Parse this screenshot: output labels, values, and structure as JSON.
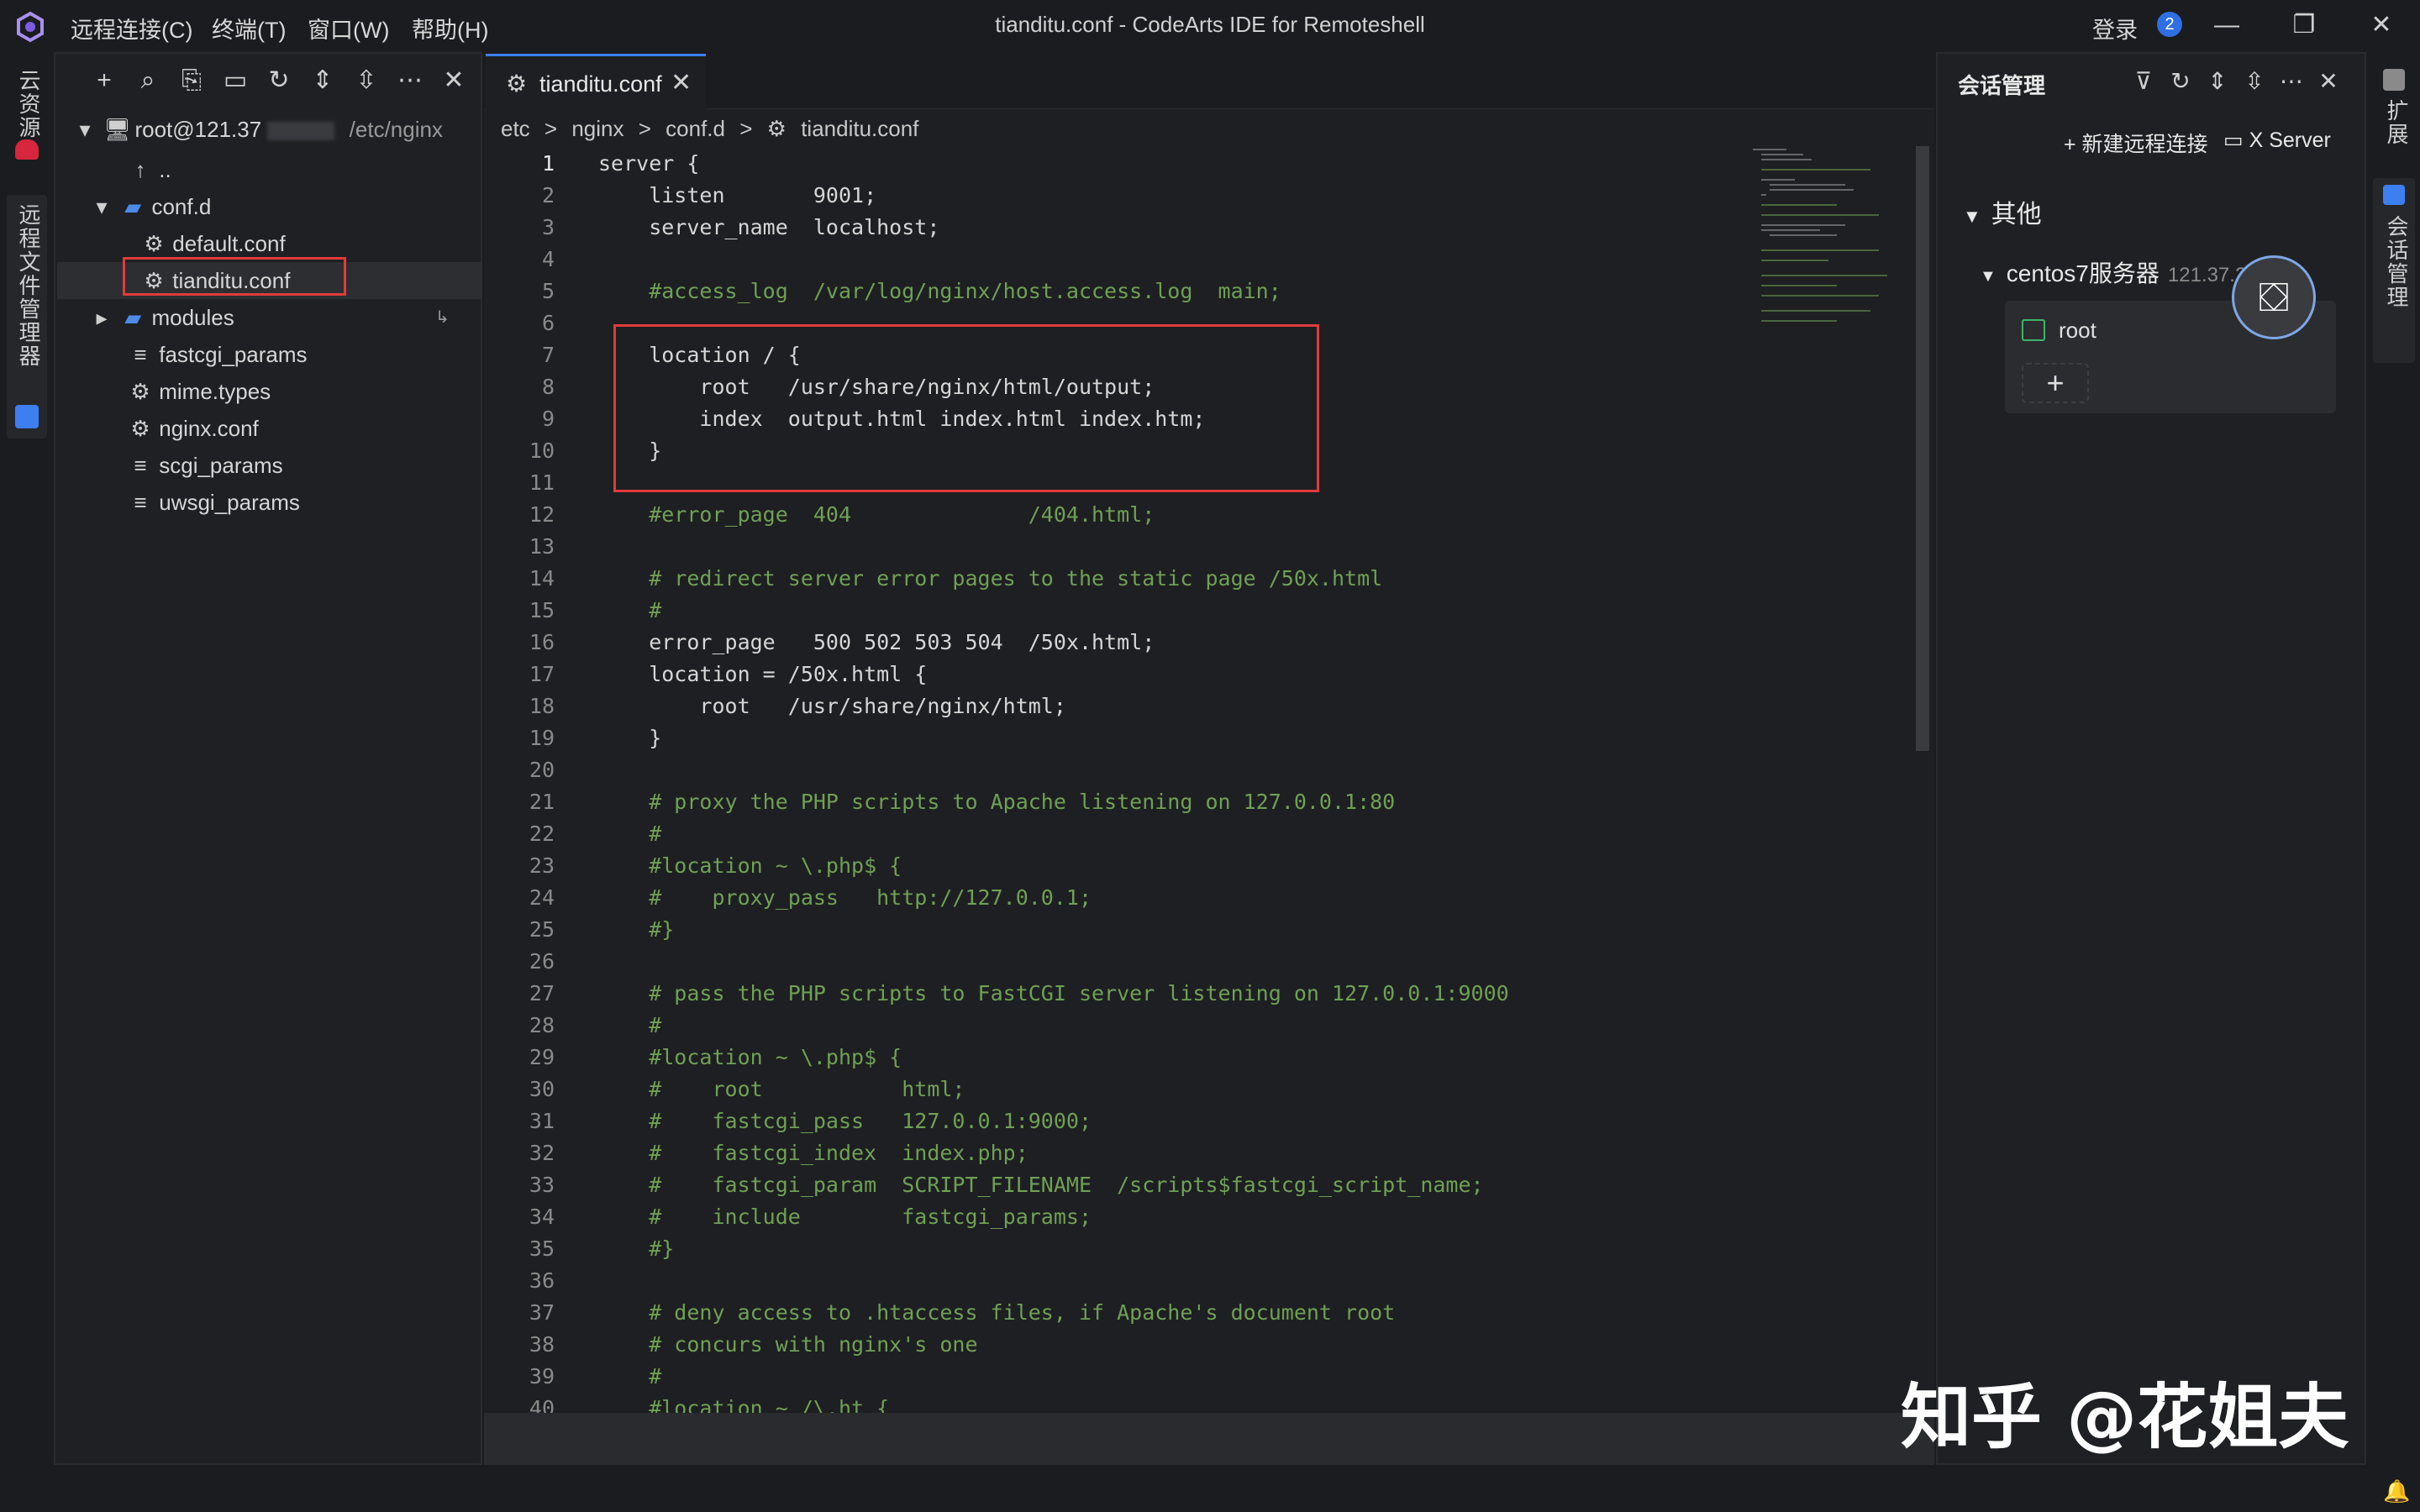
{
  "window": {
    "title": "tianditu.conf - CodeArts IDE for Remoteshell",
    "menu": [
      "远程连接(C)",
      "终端(T)",
      "窗口(W)",
      "帮助(H)"
    ],
    "login": "登录",
    "notification_count": "2"
  },
  "left_activity": {
    "cloud_resources": "云资源",
    "remote_file_manager": "远程文件管理器"
  },
  "right_activity": {
    "extensions": "扩展",
    "session_manager": "会话管理"
  },
  "explorer": {
    "root": "root@121.37",
    "root_path": "/etc/nginx",
    "items": [
      {
        "label": "..",
        "icon": "arrow-up-icon"
      },
      {
        "label": "conf.d",
        "icon": "folder-open-icon"
      },
      {
        "label": "default.conf",
        "icon": "gear-icon"
      },
      {
        "label": "tianditu.conf",
        "icon": "gear-icon"
      },
      {
        "label": "modules",
        "icon": "folder-icon"
      },
      {
        "label": "fastcgi_params",
        "icon": "file-lines-icon"
      },
      {
        "label": "mime.types",
        "icon": "gear-icon"
      },
      {
        "label": "nginx.conf",
        "icon": "gear-icon"
      },
      {
        "label": "scgi_params",
        "icon": "file-lines-icon"
      },
      {
        "label": "uwsgi_params",
        "icon": "file-lines-icon"
      }
    ]
  },
  "editor": {
    "tab": "tianditu.conf",
    "breadcrumb": [
      "etc",
      ">",
      "nginx",
      ">",
      "conf.d",
      ">",
      "tianditu.conf"
    ],
    "lines": [
      "server {",
      "    listen       9001;",
      "    server_name  localhost;",
      "",
      "    #access_log  /var/log/nginx/host.access.log  main;",
      "",
      "    location / {",
      "        root   /usr/share/nginx/html/output;",
      "        index  output.html index.html index.htm;",
      "    }",
      "",
      "    #error_page  404              /404.html;",
      "",
      "    # redirect server error pages to the static page /50x.html",
      "    #",
      "    error_page   500 502 503 504  /50x.html;",
      "    location = /50x.html {",
      "        root   /usr/share/nginx/html;",
      "    }",
      "",
      "    # proxy the PHP scripts to Apache listening on 127.0.0.1:80",
      "    #",
      "    #location ~ \\.php$ {",
      "    #    proxy_pass   http://127.0.0.1;",
      "    #}",
      "",
      "    # pass the PHP scripts to FastCGI server listening on 127.0.0.1:9000",
      "    #",
      "    #location ~ \\.php$ {",
      "    #    root           html;",
      "    #    fastcgi_pass   127.0.0.1:9000;",
      "    #    fastcgi_index  index.php;",
      "    #    fastcgi_param  SCRIPT_FILENAME  /scripts$fastcgi_script_name;",
      "    #    include        fastcgi_params;",
      "    #}",
      "",
      "    # deny access to .htaccess files, if Apache's document root",
      "    # concurs with nginx's one",
      "    #",
      "    #location ~ /\\.ht {"
    ]
  },
  "session_panel": {
    "title": "会话管理",
    "new_remote": "新建远程连接",
    "x_server": "X Server",
    "group": "其他",
    "server_name": "centos7服务器",
    "server_ip": "121.37.2",
    "session_user": "root",
    "add": "+"
  },
  "watermark": "知乎 @花姐夫",
  "colors": {
    "accent": "#3c7ff0",
    "highlight_box": "#e03b3b",
    "comment": "#6fa055"
  }
}
